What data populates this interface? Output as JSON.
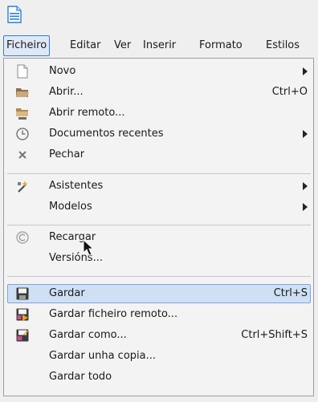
{
  "menubar": {
    "items": [
      {
        "label": "Ficheiro",
        "active": true
      },
      {
        "label": "Editar"
      },
      {
        "label": "Ver"
      },
      {
        "label": "Inserir"
      },
      {
        "label": "Formato"
      },
      {
        "label": "Estilos"
      }
    ]
  },
  "file_menu": {
    "items": [
      {
        "label": "Novo",
        "submenu": true,
        "icon": "new-document-icon"
      },
      {
        "label": "Abrir...",
        "shortcut": "Ctrl+O",
        "icon": "open-folder-icon"
      },
      {
        "label": "Abrir remoto...",
        "icon": "remote-folder-icon"
      },
      {
        "label": "Documentos recentes",
        "submenu": true,
        "icon": "clock-icon"
      },
      {
        "label": "Pechar",
        "icon": "close-icon"
      },
      {
        "label": "Asistentes",
        "submenu": true,
        "icon": "wizard-icon"
      },
      {
        "label": "Modelos",
        "submenu": true
      },
      {
        "label": "Recargar",
        "icon": "reload-icon"
      },
      {
        "label": "Versións..."
      },
      {
        "label": "Gardar",
        "shortcut": "Ctrl+S",
        "highlighted": true,
        "icon": "save-icon"
      },
      {
        "label": "Gardar ficheiro remoto...",
        "icon": "save-remote-icon"
      },
      {
        "label": "Gardar como...",
        "shortcut": "Ctrl+Shift+S",
        "icon": "save-as-icon"
      },
      {
        "label": "Gardar unha copia..."
      },
      {
        "label": "Gardar todo"
      }
    ]
  },
  "colors": {
    "highlight_bg": "#cfe0f5",
    "highlight_border": "#7aa6df",
    "menu_bg": "#f3f3f3",
    "window_bg": "#efefef"
  }
}
